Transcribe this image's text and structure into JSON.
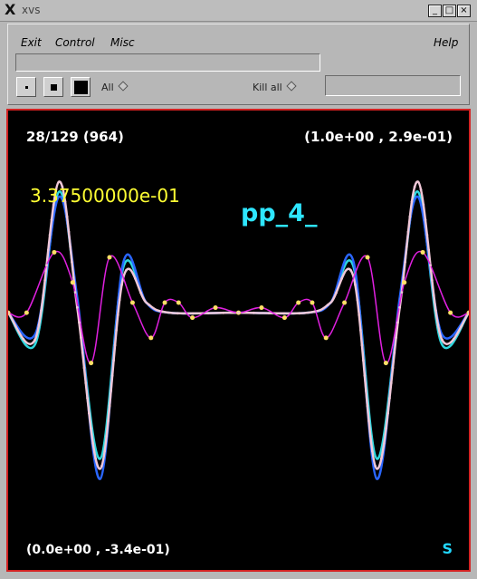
{
  "window": {
    "title": "xvs",
    "min_label": "_",
    "max_label": "□",
    "close_label": "×"
  },
  "menu": {
    "exit": "Exit",
    "control": "Control",
    "misc": "Misc",
    "help": "Help"
  },
  "controls": {
    "all_label": "All",
    "kill_label": "Kill all"
  },
  "plot": {
    "frame_info": "28/129 (964)",
    "max_coord": "(1.0e+00 , 2.9e-01)",
    "min_coord": "(0.0e+00 , -3.4e-01)",
    "value": "3.37500000e-01",
    "variable": "pp_4_",
    "mode": "S"
  },
  "colors": {
    "curve_cyan": "#2fd8e0",
    "curve_blue": "#2a66ff",
    "curve_pink": "#f0c8d8",
    "curve_magenta": "#e020e0",
    "points_yellow": "#ffe066",
    "border_red": "#d32222"
  },
  "chart_data": {
    "type": "line",
    "xlim": [
      0.0,
      1.0
    ],
    "ylim": [
      -0.34,
      0.29
    ],
    "series": [
      {
        "color": "cyan",
        "x": [
          0.0,
          0.06,
          0.11,
          0.15,
          0.2,
          0.25,
          0.3,
          0.35,
          0.5,
          0.65,
          0.7,
          0.75,
          0.8,
          0.85,
          0.89,
          0.94,
          1.0
        ],
        "y": [
          0.0,
          -0.06,
          0.24,
          0.02,
          -0.29,
          0.09,
          0.02,
          0.0,
          0.0,
          0.0,
          0.02,
          0.09,
          -0.29,
          0.02,
          0.24,
          -0.06,
          0.0
        ]
      },
      {
        "color": "blue",
        "x": [
          0.0,
          0.06,
          0.11,
          0.15,
          0.2,
          0.25,
          0.3,
          0.35,
          0.5,
          0.65,
          0.7,
          0.75,
          0.8,
          0.85,
          0.89,
          0.94,
          1.0
        ],
        "y": [
          0.0,
          -0.04,
          0.23,
          0.03,
          -0.33,
          0.1,
          0.02,
          0.0,
          0.0,
          0.0,
          0.02,
          0.1,
          -0.33,
          0.03,
          0.23,
          -0.04,
          0.0
        ]
      },
      {
        "color": "pink",
        "x": [
          0.0,
          0.06,
          0.11,
          0.15,
          0.2,
          0.25,
          0.3,
          0.35,
          0.5,
          0.65,
          0.7,
          0.75,
          0.8,
          0.85,
          0.89,
          0.94,
          1.0
        ],
        "y": [
          0.0,
          -0.05,
          0.26,
          0.01,
          -0.31,
          0.07,
          0.02,
          0.0,
          0.0,
          0.0,
          0.02,
          0.07,
          -0.31,
          0.01,
          0.26,
          -0.05,
          0.0
        ]
      },
      {
        "color": "magenta",
        "x": [
          0.0,
          0.04,
          0.1,
          0.14,
          0.18,
          0.22,
          0.27,
          0.31,
          0.34,
          0.37,
          0.4,
          0.45,
          0.5,
          0.55,
          0.6,
          0.63,
          0.66,
          0.69,
          0.73,
          0.78,
          0.82,
          0.86,
          0.9,
          0.96,
          1.0
        ],
        "y": [
          0.0,
          0.0,
          0.12,
          0.06,
          -0.1,
          0.11,
          0.02,
          -0.05,
          0.02,
          0.02,
          -0.01,
          0.01,
          0.0,
          0.01,
          -0.01,
          0.02,
          0.02,
          -0.05,
          0.02,
          0.11,
          -0.1,
          0.06,
          0.12,
          0.0,
          0.0
        ]
      }
    ]
  }
}
